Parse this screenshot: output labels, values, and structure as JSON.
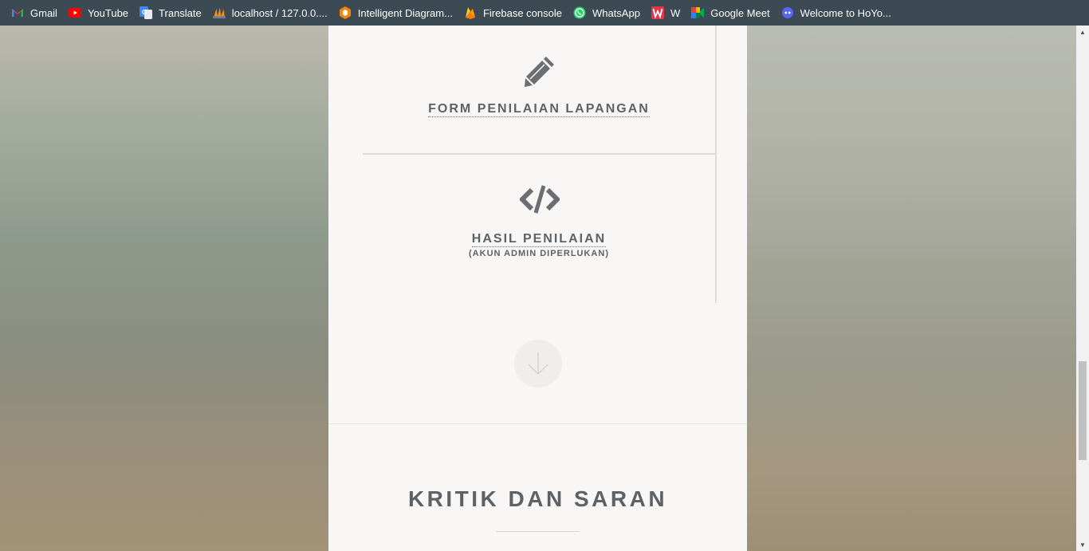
{
  "bookmarks": [
    {
      "label": "Gmail",
      "icon": "gmail-icon"
    },
    {
      "label": "YouTube",
      "icon": "youtube-icon"
    },
    {
      "label": "Translate",
      "icon": "translate-icon"
    },
    {
      "label": "localhost / 127.0.0....",
      "icon": "phpmyadmin-icon"
    },
    {
      "label": "Intelligent Diagram...",
      "icon": "diagram-icon"
    },
    {
      "label": "Firebase console",
      "icon": "firebase-icon"
    },
    {
      "label": "WhatsApp",
      "icon": "whatsapp-icon"
    },
    {
      "label": "W",
      "icon": "w-icon"
    },
    {
      "label": "Google Meet",
      "icon": "google-meet-icon"
    },
    {
      "label": "Welcome to HoYo...",
      "icon": "hoyoverse-icon"
    }
  ],
  "menu": {
    "form_title": "FORM PENILAIAN LAPANGAN",
    "results_title": "HASIL PENILAIAN",
    "results_note": "(AKUN ADMIN DIPERLUKAN)"
  },
  "section": {
    "title": "KRITIK DAN SARAN"
  },
  "colors": {
    "bookmark_bar": "#3c4a54",
    "panel": "#f8f7f6",
    "text": "#5d6266",
    "icon": "#6b6f73"
  }
}
